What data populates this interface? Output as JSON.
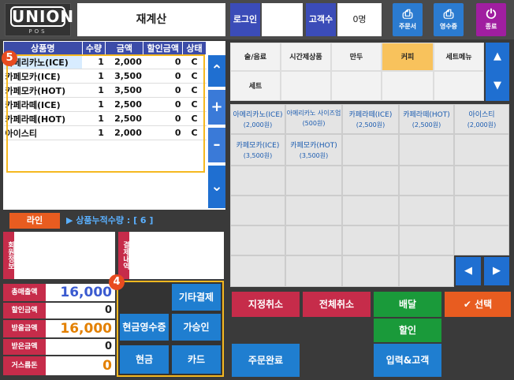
{
  "app": {
    "logo_text": "UNION",
    "logo_sub": "POS",
    "screen_title": "재계산",
    "login_label": "로그인",
    "login_value": "",
    "customers_label": "고객수",
    "customers_value": "0명",
    "buttons": {
      "order": "주문서",
      "receipt": "영수증",
      "exit": "종료"
    }
  },
  "order_table": {
    "headers": [
      "상품명",
      "수량",
      "금액",
      "할인금액",
      "상태"
    ],
    "rows": [
      {
        "name": "아메리카노(ICE)",
        "qty": "1",
        "amount": "2,000",
        "discount": "0",
        "status": "C"
      },
      {
        "name": "카페모카(ICE)",
        "qty": "1",
        "amount": "3,500",
        "discount": "0",
        "status": "C"
      },
      {
        "name": "카페모카(HOT)",
        "qty": "1",
        "amount": "3,500",
        "discount": "0",
        "status": "C"
      },
      {
        "name": "카페라떼(ICE)",
        "qty": "1",
        "amount": "2,500",
        "discount": "0",
        "status": "C"
      },
      {
        "name": "카페라떼(HOT)",
        "qty": "1",
        "amount": "2,500",
        "discount": "0",
        "status": "C"
      },
      {
        "name": "아이스티",
        "qty": "1",
        "amount": "2,000",
        "discount": "0",
        "status": "C"
      }
    ],
    "badge": "5"
  },
  "line_button": "라인",
  "accum_text": "▶ 상품누적수량 : [ 6 ]",
  "member_label": "회원정보",
  "payment_label": "결제내역",
  "summary": {
    "total_sales_label": "총매출액",
    "total_sales": "16,000",
    "discount_label": "할인금액",
    "discount": "0",
    "receivable_label": "받을금액",
    "receivable": "16,000",
    "received_label": "받은금액",
    "received": "0",
    "change_label": "거스름돈",
    "change": "0"
  },
  "pay_badge": "4",
  "pay_buttons": {
    "other": "기타결제",
    "cash_receipt": "현금영수증",
    "card_approval": "가승인",
    "cash": "현금",
    "card": "카드"
  },
  "categories": [
    "술/음료",
    "시간제상품",
    "만두",
    "커피",
    "세트메뉴",
    "세트"
  ],
  "active_category": "커피",
  "products": [
    {
      "name": "아메리카노(ICE)",
      "price": "(2,000원)"
    },
    {
      "name": "아메리카노 사이즈업",
      "price": "(500원)"
    },
    {
      "name": "카페라떼(ICE)",
      "price": "(2,500원)"
    },
    {
      "name": "카페라떼(HOT)",
      "price": "(2,500원)"
    },
    {
      "name": "아이스티",
      "price": "(2,000원)"
    },
    {
      "name": "카페모카(ICE)",
      "price": "(3,500원)"
    },
    {
      "name": "카페모카(HOT)",
      "price": "(3,500원)"
    }
  ],
  "actions": {
    "cancel_selected": "지정취소",
    "cancel_all": "전체취소",
    "delivery": "배달",
    "select": "선택",
    "discount": "할인",
    "complete_order": "주문완료",
    "input_customer": "입력&고객"
  },
  "colors": {
    "header_blue": "#3c4ca8",
    "button_blue": "#1f7ed0",
    "accent_orange": "#e85c20",
    "active_category": "#f8c25c",
    "green": "#1a9a3a",
    "red": "#c62c4a"
  }
}
